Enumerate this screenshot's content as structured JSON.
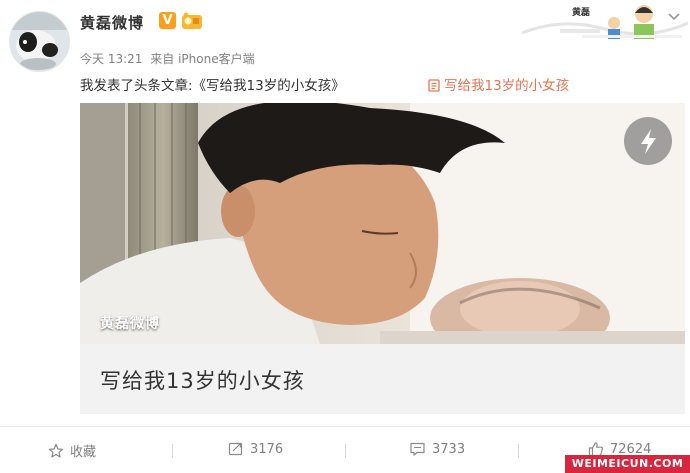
{
  "post": {
    "username": "黄磊微博",
    "vip_mark": "V",
    "time": "今天 13:21",
    "source_prefix": "来自",
    "source": "iPhone客户端",
    "text": "我发表了头条文章:《写给我13岁的小女孩》",
    "article_link_text": "写给我13岁的小女孩",
    "banner_text": "黄磊"
  },
  "article": {
    "photo_caption": "黄磊微博",
    "title": "写给我13岁的小女孩"
  },
  "actions": {
    "favorite_label": "收藏",
    "repost_count": "3176",
    "comment_count": "3733",
    "like_count": "72624"
  },
  "watermark": "WEIMEICUN.COM",
  "icons": [
    "avatar-image",
    "vip-badge",
    "gold-medal-icon",
    "dropdown-icon",
    "document-icon",
    "lightning-icon",
    "star-icon",
    "repost-icon",
    "comment-icon",
    "thumbs-up-icon"
  ],
  "colors": {
    "link": "#eb7350",
    "vip": "#f9a11b",
    "muted": "#808080",
    "watermark_bg": "#d7263d"
  }
}
